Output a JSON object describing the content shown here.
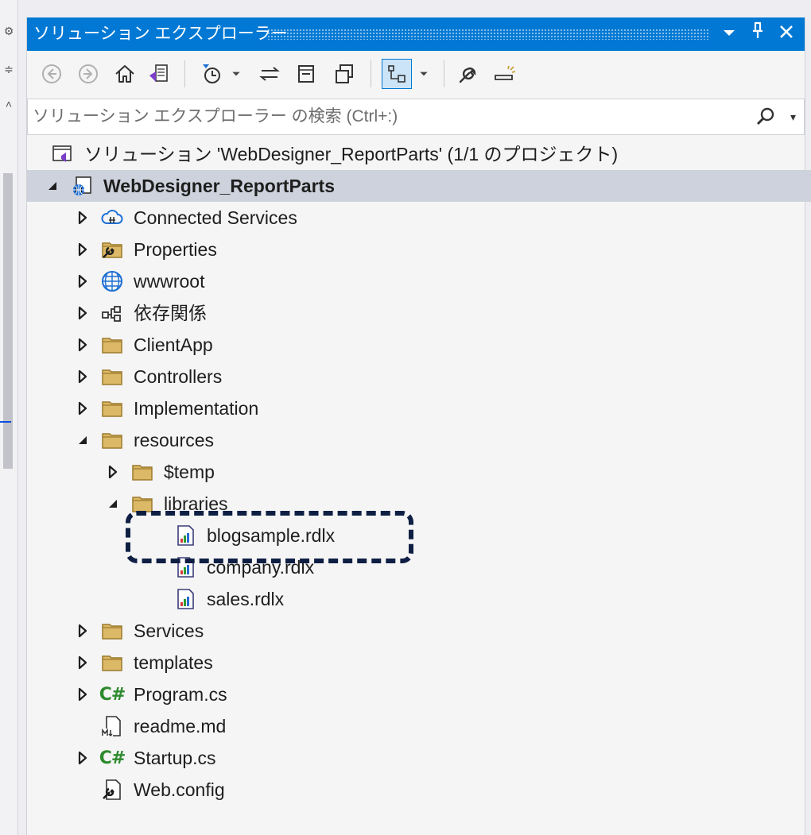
{
  "panel": {
    "title": "ソリューション エクスプローラー",
    "controls": [
      "dropdown-icon",
      "pin-icon",
      "close-icon"
    ]
  },
  "toolbar": {
    "buttons": [
      "back-icon",
      "forward-icon",
      "home-icon",
      "switch-views-icon",
      "pending-changes-filter-icon",
      "dropdown-icon",
      "sync-icon",
      "collapse-all-icon",
      "copy-icon",
      "show-all-files-icon",
      "dropdown-icon",
      "properties-wrench-icon",
      "preview-icon"
    ]
  },
  "search": {
    "placeholder": "ソリューション エクスプローラー の検索 (Ctrl+:)"
  },
  "tree": {
    "solution": "ソリューション 'WebDesigner_ReportParts' (1/1 のプロジェクト)",
    "project": "WebDesigner_ReportParts",
    "items": [
      {
        "label": "Connected Services",
        "icon": "connected-services-icon",
        "expander": "collapsed"
      },
      {
        "label": "Properties",
        "icon": "properties-folder-icon",
        "expander": "collapsed"
      },
      {
        "label": "wwwroot",
        "icon": "globe-icon",
        "expander": "collapsed"
      },
      {
        "label": "依存関係",
        "icon": "dependencies-icon",
        "expander": "collapsed"
      },
      {
        "label": "ClientApp",
        "icon": "folder-icon",
        "expander": "collapsed"
      },
      {
        "label": "Controllers",
        "icon": "folder-icon",
        "expander": "collapsed"
      },
      {
        "label": "Implementation",
        "icon": "folder-icon",
        "expander": "collapsed"
      },
      {
        "label": "resources",
        "icon": "folder-icon",
        "expander": "expanded"
      },
      {
        "label": "$temp",
        "icon": "folder-icon",
        "expander": "collapsed"
      },
      {
        "label": "libraries",
        "icon": "folder-icon",
        "expander": "expanded"
      },
      {
        "label": "blogsample.rdlx",
        "icon": "report-file-icon",
        "expander": "none"
      },
      {
        "label": "company.rdlx",
        "icon": "report-file-icon",
        "expander": "none"
      },
      {
        "label": "sales.rdlx",
        "icon": "report-file-icon",
        "expander": "none"
      },
      {
        "label": "Services",
        "icon": "folder-icon",
        "expander": "collapsed"
      },
      {
        "label": "templates",
        "icon": "folder-icon",
        "expander": "collapsed"
      },
      {
        "label": "Program.cs",
        "icon": "csharp-file-icon",
        "expander": "collapsed"
      },
      {
        "label": "readme.md",
        "icon": "markdown-file-icon",
        "expander": "none"
      },
      {
        "label": "Startup.cs",
        "icon": "csharp-file-icon",
        "expander": "collapsed"
      },
      {
        "label": "Web.config",
        "icon": "config-file-icon",
        "expander": "none"
      }
    ]
  },
  "colors": {
    "titlebar": "#0078d4",
    "selected_row": "#cdd2dc",
    "folder": "#c9a64f",
    "highlight_border": "#0f1f44"
  }
}
